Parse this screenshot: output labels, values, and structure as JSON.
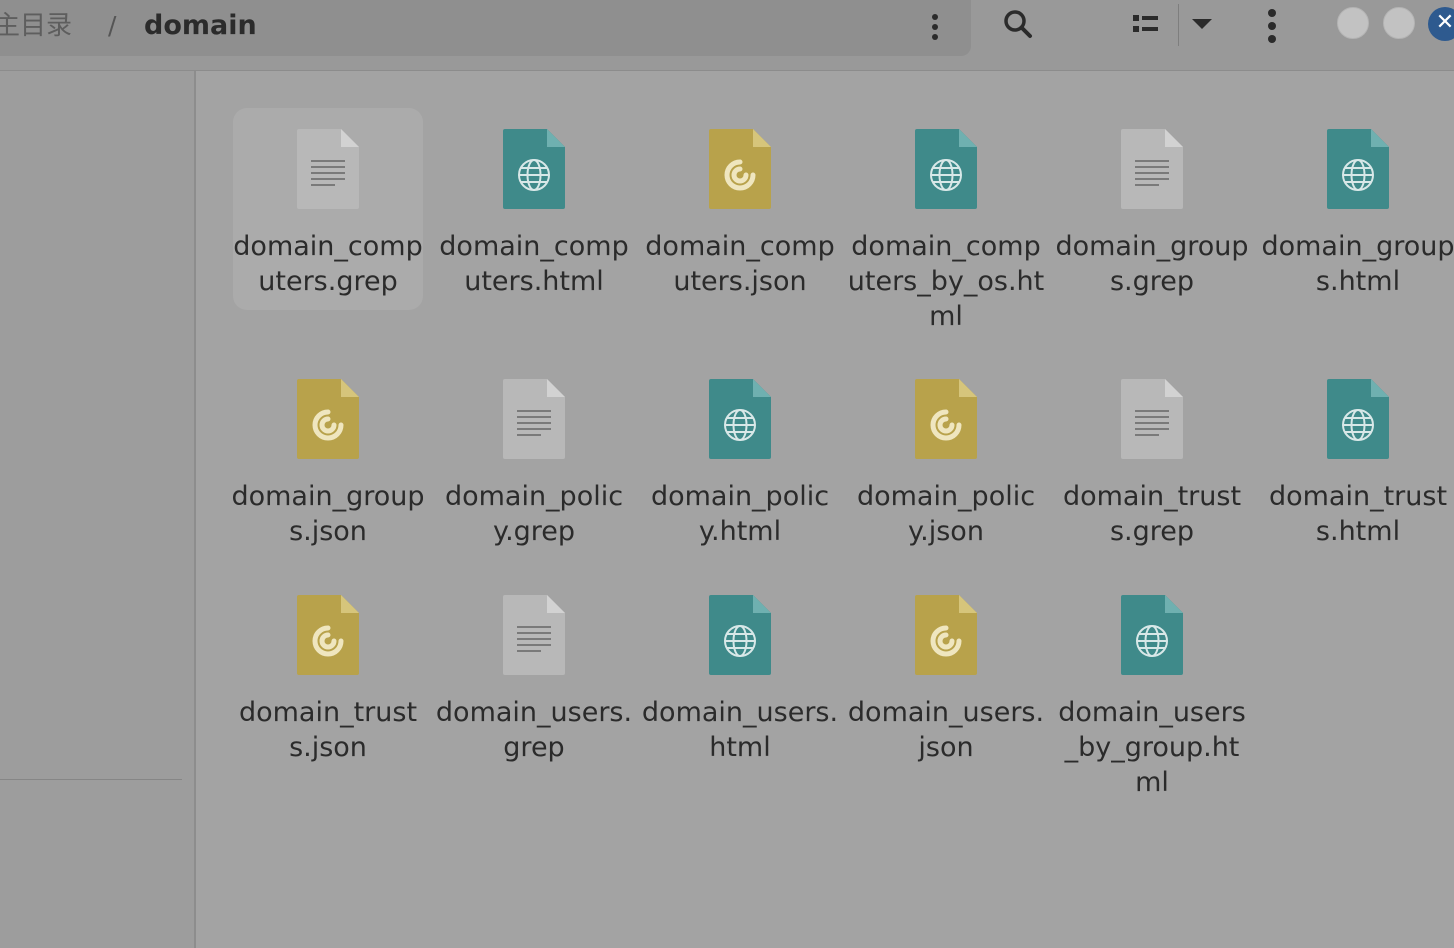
{
  "header": {
    "breadcrumb_home": "主目录",
    "breadcrumb_separator": "/",
    "breadcrumb_current": "domain",
    "icons": [
      "more-vert-icon",
      "search-icon",
      "list-view-icon",
      "dropdown-icon",
      "menu-icon",
      "minimize-icon",
      "maximize-icon",
      "close-icon"
    ]
  },
  "colors": {
    "text_file": "#b8b8b8",
    "html_file": "#3f8a8a",
    "json_file": "#b8a24b",
    "close_button": "#2e5a8f"
  },
  "files": [
    {
      "name": "domain_computers.grep",
      "type": "text",
      "selected": true
    },
    {
      "name": "domain_computers.html",
      "type": "html"
    },
    {
      "name": "domain_computers.json",
      "type": "json"
    },
    {
      "name": "domain_computers_by_os.html",
      "type": "html"
    },
    {
      "name": "domain_groups.grep",
      "type": "text"
    },
    {
      "name": "domain_groups.html",
      "type": "html"
    },
    {
      "name": "domain_groups.json",
      "type": "json"
    },
    {
      "name": "domain_policy.grep",
      "type": "text"
    },
    {
      "name": "domain_policy.html",
      "type": "html"
    },
    {
      "name": "domain_policy.json",
      "type": "json"
    },
    {
      "name": "domain_trusts.grep",
      "type": "text"
    },
    {
      "name": "domain_trusts.html",
      "type": "html"
    },
    {
      "name": "domain_trusts.json",
      "type": "json"
    },
    {
      "name": "domain_users.grep",
      "type": "text"
    },
    {
      "name": "domain_users.html",
      "type": "html"
    },
    {
      "name": "domain_users.json",
      "type": "json"
    },
    {
      "name": "domain_users_by_group.html",
      "type": "html"
    }
  ]
}
